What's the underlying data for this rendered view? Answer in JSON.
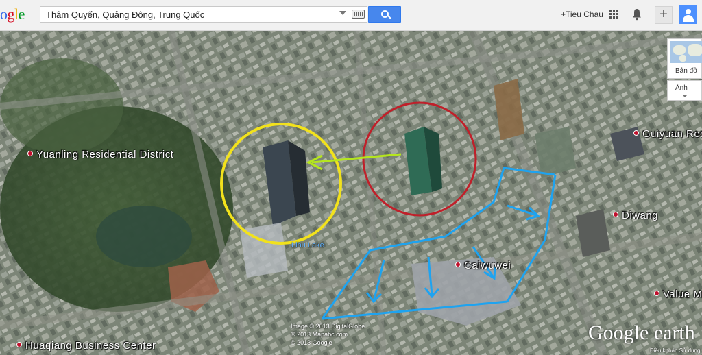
{
  "header": {
    "logo_text": "ogle",
    "search_value": "Thâm Quyến, Quảng Đông, Trung Quốc",
    "user_link": "+Tieu Chau"
  },
  "map": {
    "places": {
      "yuanling": "Yuanling Residential District",
      "guiyuan": "Guiyuan Res",
      "diwang": "Diwang",
      "caiwuwei": "Caiwuwei",
      "value": "Value M",
      "huaqiang": "Huaqiang Business Center",
      "lizhi": "Lihu Lake"
    },
    "attribution": {
      "line1": "Image © 2013 DigitalGlobe",
      "line2": "© 2013 Mapabc.com",
      "line3": "© 2013 Google"
    },
    "brand": "Google earth",
    "terms": "Điều khoản Sử dụng",
    "layer_switch": {
      "map_label": "Bản đồ",
      "image_label": "Ảnh"
    },
    "annotation_colors": {
      "yellow_circle": "#f2e21c",
      "red_circle": "#c0202a",
      "green_arrow": "#b5e61d",
      "blue_arrows": "#1ea3f0"
    }
  }
}
